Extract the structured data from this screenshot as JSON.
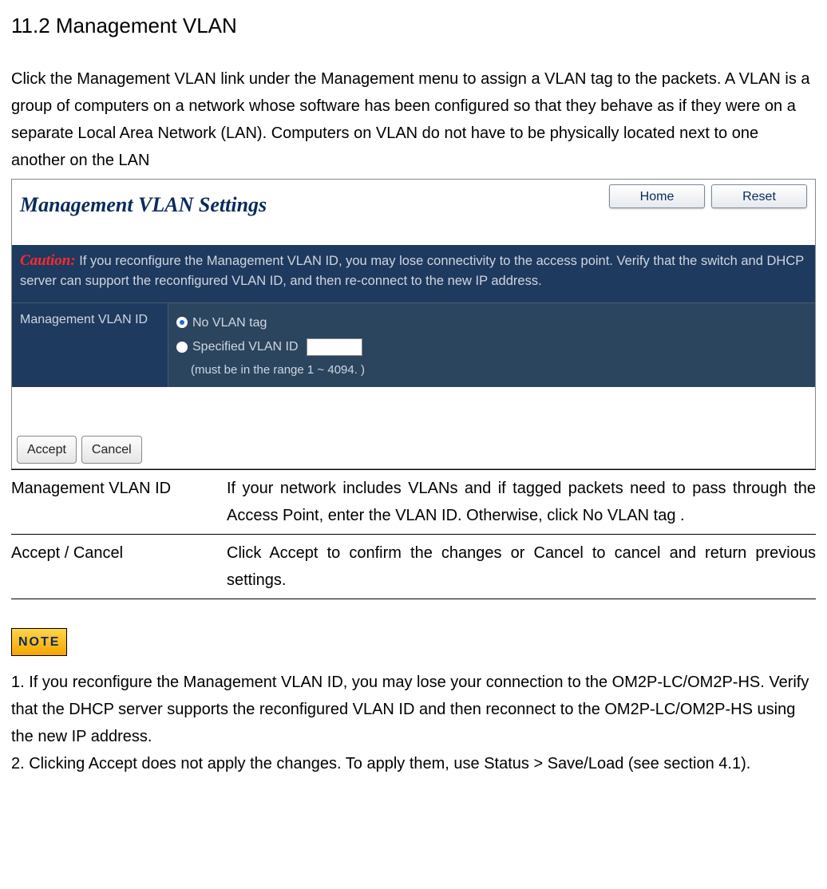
{
  "heading": "11.2 Management VLAN",
  "intro": "Click the Management VLAN link under the Management menu to assign a VLAN tag to the packets. A VLAN is a group of computers on a network whose software has been configured so that they behave as if they were on a separate Local Area Network (LAN). Computers on VLAN do not have to be physically located next to one another on the LAN",
  "screenshot": {
    "title": "Management VLAN Settings",
    "home_btn": "Home",
    "reset_btn": "Reset",
    "caution_label": "Caution:",
    "caution_text": " If you reconfigure the Management VLAN ID, you may lose connectivity to the access point. Verify that the switch and DHCP server can support the reconfigured VLAN ID, and then re-connect to the new IP address.",
    "field_label": "Management VLAN ID",
    "radio_no_tag": "No VLAN tag",
    "radio_specified": "Specified VLAN ID",
    "range_hint": "(must be in the range 1 ~ 4094. )",
    "accept_btn": "Accept",
    "cancel_btn": "Cancel"
  },
  "table": {
    "row1_key": "Management VLAN ID",
    "row1_val": "If your network includes VLANs and if tagged packets need to pass through  the Access Point,  enter the VLAN ID. Otherwise, click No VLAN tag .",
    "row2_key": "Accept / Cancel",
    "row2_val": "Click Accept to confirm the changes or Cancel to cancel and return previous settings."
  },
  "note_badge": "NOTE",
  "note1": "1. If you reconfigure the Management VLAN ID, you may lose your connection to the OM2P-LC/OM2P-HS. Verify that the DHCP server supports the reconfigured VLAN ID and then reconnect to the OM2P-LC/OM2P-HS using the new IP address.",
  "note2": "2. Clicking Accept does not apply the changes. To apply them, use Status > Save/Load (see section 4.1)."
}
